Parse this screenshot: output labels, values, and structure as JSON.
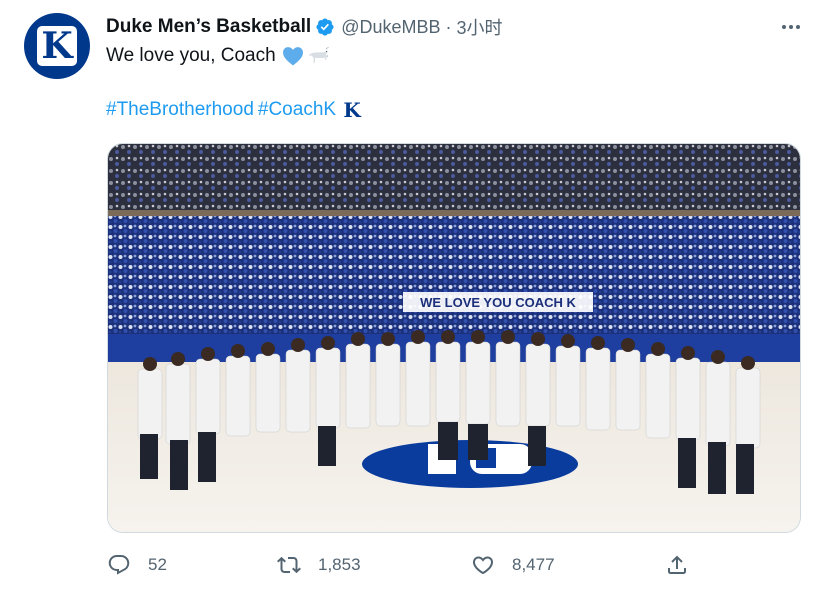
{
  "tweet": {
    "author": {
      "display_name": "Duke Men’s Basketball",
      "handle": "@DukeMBB",
      "separator": "·",
      "time": "3小时",
      "avatar_letter": "K",
      "verified": true
    },
    "text": "We love you, Coach",
    "emojis": [
      "blue-heart-icon",
      "goat-icon"
    ],
    "hashtags": [
      "#TheBrotherhood",
      "#CoachK"
    ],
    "hashtag_emoji": "K",
    "media": {
      "sign_text": "WE LOVE YOU COACH K",
      "court_logo": "D"
    },
    "actions": {
      "reply_count": "52",
      "retweet_count": "1,853",
      "like_count": "8,477"
    }
  },
  "colors": {
    "brand": "#00388c",
    "link": "#1d9bf0",
    "muted": "#536471",
    "verified": "#1d9bf0"
  }
}
